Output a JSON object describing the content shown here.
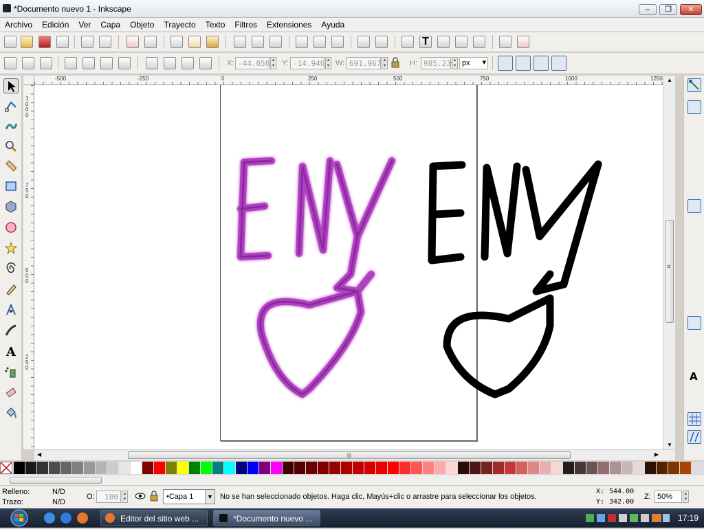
{
  "window": {
    "title": "*Documento nuevo 1 - Inkscape",
    "minimize": "‒",
    "maximize": "❐",
    "close": "✕"
  },
  "menu": [
    "Archivo",
    "Edición",
    "Ver",
    "Capa",
    "Objeto",
    "Trayecto",
    "Texto",
    "Filtros",
    "Extensiones",
    "Ayuda"
  ],
  "toolcontrols": {
    "x_label": "X:",
    "x_value": "-44.050",
    "y_label": "Y:",
    "y_value": "-14.946",
    "w_label": "W:",
    "w_value": "691.967",
    "h_label": "H:",
    "h_value": "985.236",
    "unit": "px"
  },
  "hruler_labels": [
    "-500",
    "-250",
    "0",
    "250",
    "500",
    "750",
    "1000",
    "1250"
  ],
  "vruler_labels": [
    "1000",
    "750",
    "500",
    "250"
  ],
  "hscroll_grip": "|||",
  "vscroll_grip": "≡",
  "drawing": {
    "left_text": "ENy",
    "right_text": "ENy",
    "left_color": "#b040c0",
    "right_color": "#000000"
  },
  "status": {
    "fill_label": "Relleno:",
    "fill_value": "N/D",
    "stroke_label": "Trazo:",
    "stroke_value": "N/D",
    "opacity_label": "O:",
    "opacity_value": "100",
    "layer": "•Capa 1",
    "message": "No se han seleccionado objetos. Haga clic, Mayús+clic o arrastre para seleccionar los objetos.",
    "cursor_x_label": "X:",
    "cursor_x": "544.00",
    "cursor_y_label": "Y:",
    "cursor_y": "342.00",
    "zoom_label": "Z:",
    "zoom": "50%"
  },
  "taskbar": {
    "items": [
      "Editor del sitio web ...",
      "*Documento nuevo ..."
    ],
    "time": "17:19"
  },
  "palette_colors": [
    "#000000",
    "#1a1a1a",
    "#333333",
    "#4d4d4d",
    "#666666",
    "#808080",
    "#999999",
    "#b3b3b3",
    "#cccccc",
    "#e6e6e6",
    "#ffffff",
    "#800000",
    "#ff0000",
    "#808000",
    "#ffff00",
    "#008000",
    "#00ff00",
    "#008080",
    "#00ffff",
    "#000080",
    "#0000ff",
    "#800080",
    "#ff00ff",
    "#3d0000",
    "#550000",
    "#6a0000",
    "#800000",
    "#950000",
    "#aa0000",
    "#c00000",
    "#d40000",
    "#ea0000",
    "#ff0000",
    "#ff2a2a",
    "#ff5555",
    "#ff8080",
    "#ffaaaa",
    "#ffd5d5",
    "#280b0b",
    "#501616",
    "#782121",
    "#a02c2c",
    "#c83737",
    "#d35f5f",
    "#de8787",
    "#e9afaf",
    "#f4d7d7",
    "#241c1c",
    "#483737",
    "#6c5353",
    "#916f6f",
    "#ac9393",
    "#c8b7b7",
    "#e3dbdb",
    "#2b1100",
    "#552200",
    "#803300",
    "#aa4400",
    "#d45500",
    "#ff6600"
  ]
}
